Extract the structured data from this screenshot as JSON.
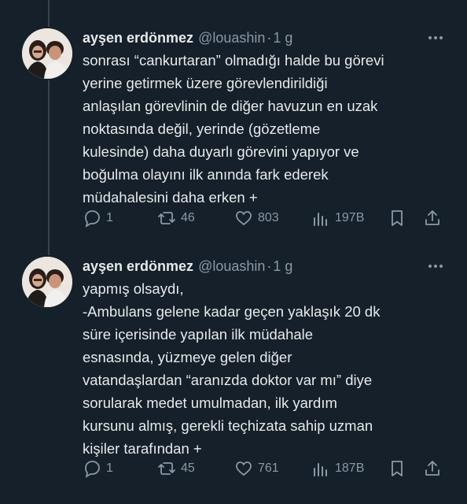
{
  "tweets": [
    {
      "author_name": "ayşen erdönmez",
      "handle": "@louashin",
      "separator": "·",
      "time": "1 g",
      "text_lines": [
        "sonrası “cankurtaran” olmadığı halde bu görevi",
        "yerine getirmek üzere görevlendirildiği",
        "anlaşılan görevlinin de diğer havuzun en uzak",
        "noktasında değil, yerinde (gözetleme",
        "kulesinde) daha duyarlı görevini yapıyor ve",
        "boğulma olayını ilk anında fark ederek",
        "müdahalesini daha erken +"
      ],
      "replies": "1",
      "retweets": "46",
      "likes": "803",
      "views": "197B"
    },
    {
      "author_name": "ayşen erdönmez",
      "handle": "@louashin",
      "separator": "·",
      "time": "1 g",
      "text_lines": [
        "yapmış olsaydı,",
        "-Ambulans gelene kadar geçen yaklaşık 20 dk",
        "süre içerisinde yapılan ilk müdahale",
        "esnasında, yüzmeye gelen diğer",
        "vatandaşlardan “aranızda doktor var mı” diye",
        "sorularak medet umulmadan, ilk yardım",
        "kursunu almış, gerekli teçhizata sahip uzman",
        "kişiler tarafından +"
      ],
      "replies": "1",
      "retweets": "45",
      "likes": "761",
      "views": "187B"
    }
  ],
  "icons": {
    "reply": "reply-icon",
    "retweet": "retweet-icon",
    "like": "heart-icon",
    "views": "views-icon",
    "bookmark": "bookmark-icon",
    "share": "share-icon",
    "more": "more-icon"
  },
  "colors": {
    "background": "#15202b",
    "text": "#e7e9ea",
    "muted": "#8b98a5",
    "thread_line": "#38444d"
  }
}
